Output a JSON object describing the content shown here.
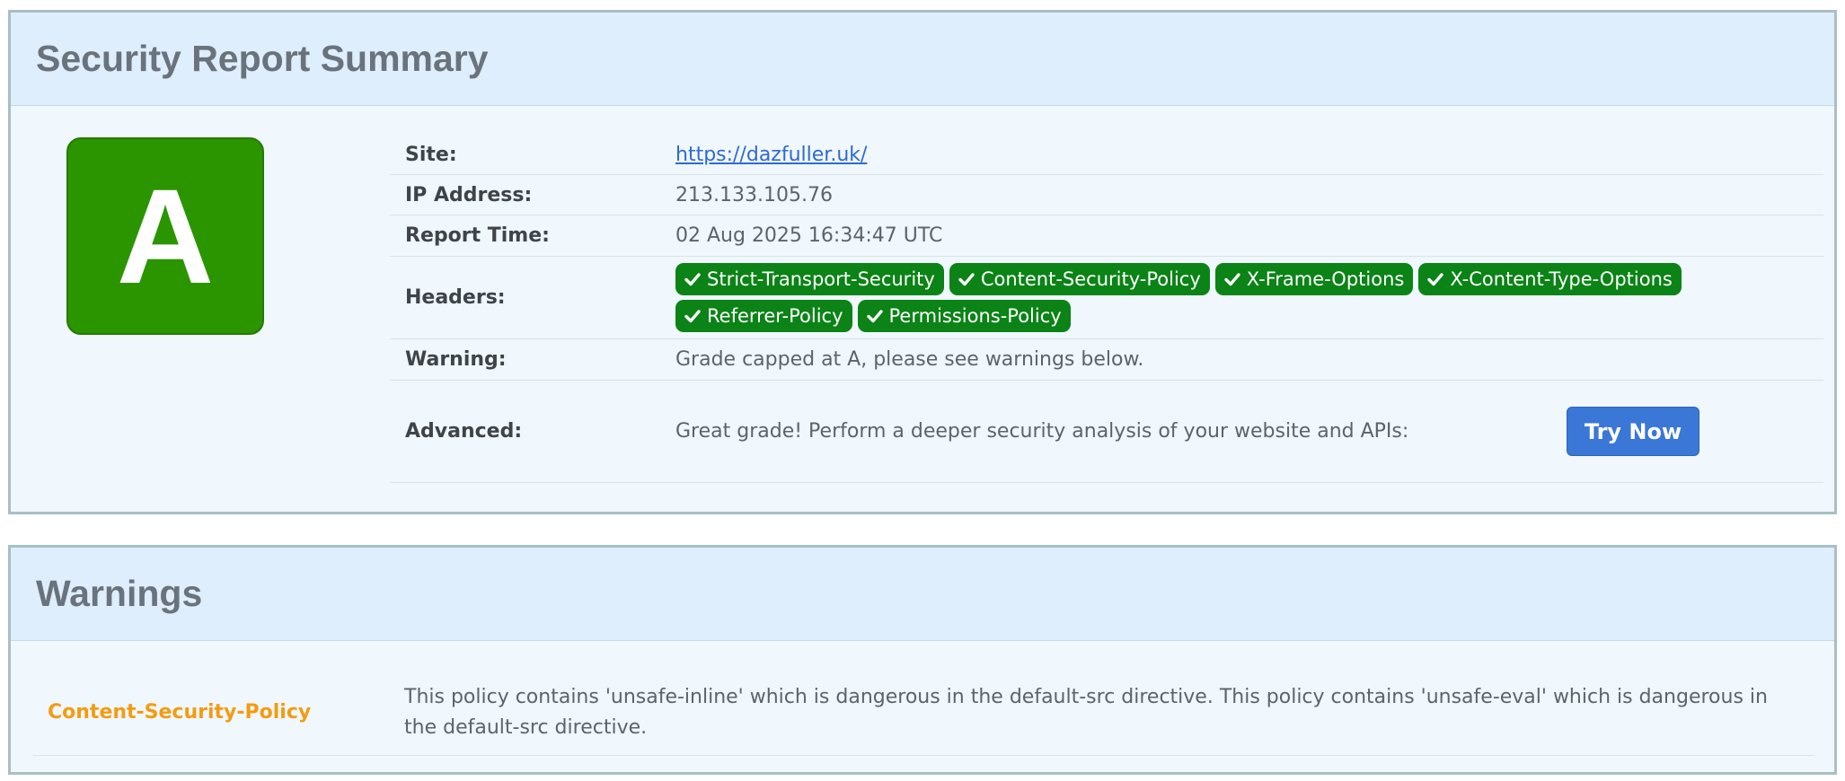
{
  "summary": {
    "title": "Security Report Summary",
    "grade": "A",
    "site_label": "Site:",
    "site_url": "https://dazfuller.uk/",
    "ip_label": "IP Address:",
    "ip": "213.133.105.76",
    "time_label": "Report Time:",
    "time": "02 Aug 2025 16:34:47 UTC",
    "headers_label": "Headers:",
    "headers": [
      "Strict-Transport-Security",
      "Content-Security-Policy",
      "X-Frame-Options",
      "X-Content-Type-Options",
      "Referrer-Policy",
      "Permissions-Policy"
    ],
    "warning_label": "Warning:",
    "warning": "Grade capped at A, please see warnings below.",
    "advanced_label": "Advanced:",
    "advanced_text": "Great grade! Perform a deeper security analysis of your website and APIs:",
    "try_button": "Try Now"
  },
  "warnings": {
    "title": "Warnings",
    "items": [
      {
        "name": "Content-Security-Policy",
        "text": "This policy contains 'unsafe-inline' which is dangerous in the default-src directive. This policy contains 'unsafe-eval' which is dangerous in the default-src directive."
      }
    ]
  },
  "colors": {
    "grade_green": "#2b9500",
    "badge_green": "#0b8316",
    "button_blue": "#3a77d6",
    "warning_orange": "#f39c12",
    "link_blue": "#2e6bd0"
  },
  "icons": {
    "header_badge": "check-icon"
  }
}
